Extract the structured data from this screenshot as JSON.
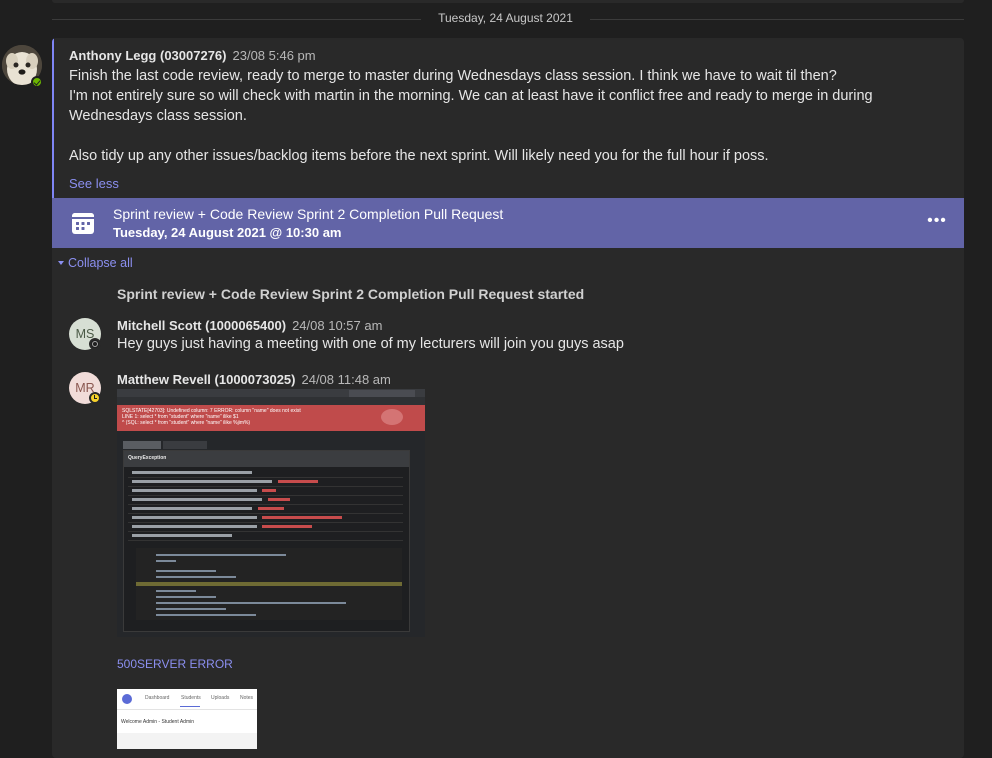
{
  "date_divider": "Tuesday, 24 August 2021",
  "post": {
    "author": "Anthony Legg (03007276)",
    "time": "23/08 5:46 pm",
    "lines": [
      "Finish the last code review, ready to merge to master during Wednesdays class session. I think we have to wait til then?",
      "I'm not entirely sure so will check with martin in the morning. We can at least have it conflict free and ready to merge in during Wednesdays class session.",
      "Also tidy up any other issues/backlog items before the next sprint. Will likely need you for the full hour if poss."
    ],
    "see_less": "See less",
    "presence": "available"
  },
  "meeting": {
    "title": "Sprint review + Code Review Sprint 2 Completion Pull Request",
    "time": "Tuesday, 24 August 2021 @ 10:30 am",
    "more_icon": "more-horizontal-icon"
  },
  "collapse_all": "Collapse all",
  "system_message": "Sprint review + Code Review Sprint 2 Completion Pull Request started",
  "replies": [
    {
      "initials": "MS",
      "author": "Mitchell Scott (1000065400)",
      "time": "24/08 10:57 am",
      "text": "Hey guys just having a meeting with one of my lecturers will join you guys asap",
      "presence": "offline"
    },
    {
      "initials": "MR",
      "author": "Matthew Revell (1000073025)",
      "time": "24/08 11:48 am",
      "presence": "away",
      "link_text": "500SERVER ERROR"
    }
  ],
  "screenshot1": {
    "error_lines": [
      "SQLSTATE[42703]: Undefined column: 7 ERROR: column \"name\" does not exist",
      "LINE 1: select * from \"student\" where \"name\" ilike $1",
      "^ (SQL: select * from \"student\" where \"name\" ilike %jim%)"
    ],
    "panel_label": "QueryException"
  },
  "screenshot2": {
    "nav": [
      "Dashboard",
      "Students",
      "Uploads",
      "Notes"
    ],
    "welcome": "Welcome Admin - Student Admin"
  },
  "colors": {
    "accent": "#7f85f5",
    "meeting_card": "#6264a7",
    "background": "#1f1f1f",
    "post_background": "#292929"
  }
}
